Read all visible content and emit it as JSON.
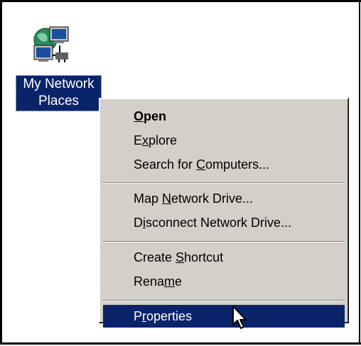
{
  "desktop": {
    "icon": {
      "name": "network-places-icon",
      "label_line1": "My Network",
      "label_line2": "Places"
    }
  },
  "context_menu": {
    "items": [
      {
        "label": "Open",
        "mnemonic_prefix": "",
        "mnemonic": "O",
        "rest": "pen",
        "bold": true
      },
      {
        "label": "Explore",
        "mnemonic_prefix": "E",
        "mnemonic": "x",
        "rest": "plore"
      },
      {
        "label": "Search for Computers...",
        "mnemonic_prefix": "Search for ",
        "mnemonic": "C",
        "rest": "omputers..."
      },
      {
        "label": "Map Network Drive...",
        "mnemonic_prefix": "Map ",
        "mnemonic": "N",
        "rest": "etwork Drive..."
      },
      {
        "label": "Disconnect Network Drive...",
        "mnemonic_prefix": "D",
        "mnemonic": "i",
        "rest": "sconnect Network Drive..."
      },
      {
        "label": "Create Shortcut",
        "mnemonic_prefix": "Create ",
        "mnemonic": "S",
        "rest": "hortcut"
      },
      {
        "label": "Rename",
        "mnemonic_prefix": "Rena",
        "mnemonic": "m",
        "rest": "e"
      },
      {
        "label": "Properties",
        "mnemonic_prefix": "P",
        "mnemonic": "r",
        "rest": "operties",
        "highlighted": true
      }
    ]
  },
  "colors": {
    "selection": "#0a246a",
    "menu_face": "#d4d0c8"
  },
  "cursor": "arrow-pointer-icon"
}
